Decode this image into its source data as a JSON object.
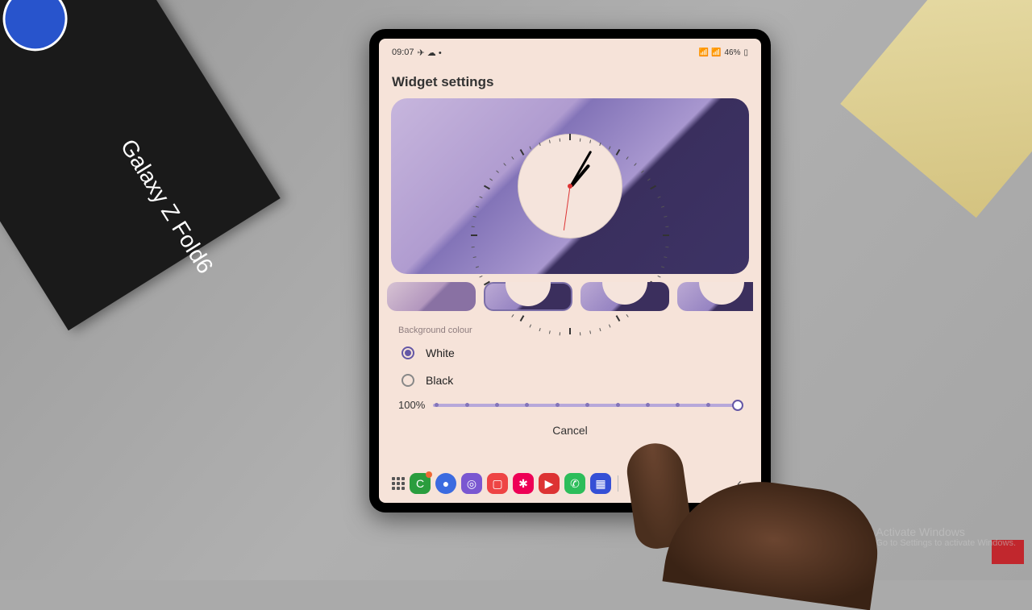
{
  "status": {
    "time": "09:07",
    "battery": "46%",
    "icons": "📶 📶"
  },
  "page": {
    "title": "Widget settings",
    "section_label": "Background colour"
  },
  "radio": {
    "white": "White",
    "black": "Black",
    "selected": "white"
  },
  "slider": {
    "value": "100%"
  },
  "cancel": "Cancel",
  "watermark": {
    "line1": "Activate Windows",
    "line2": "Go to Settings to activate Windows."
  },
  "box_label": "Galaxy Z Fold6",
  "app_icons": [
    {
      "name": "phone",
      "color": "#2a9d3e",
      "glyph": "C",
      "badge": true
    },
    {
      "name": "messages",
      "color": "#3b6be0",
      "glyph": "●",
      "round": true
    },
    {
      "name": "browser",
      "color": "#7a57d1",
      "glyph": "◎"
    },
    {
      "name": "notes",
      "color": "#e44",
      "glyph": "▢"
    },
    {
      "name": "settings",
      "color": "#e05",
      "glyph": "✱"
    },
    {
      "name": "youtube",
      "color": "#d33",
      "glyph": "▶"
    },
    {
      "name": "whatsapp",
      "color": "#2dbd5a",
      "glyph": "✆"
    },
    {
      "name": "calendar",
      "color": "#3550d6",
      "glyph": "▦"
    }
  ]
}
